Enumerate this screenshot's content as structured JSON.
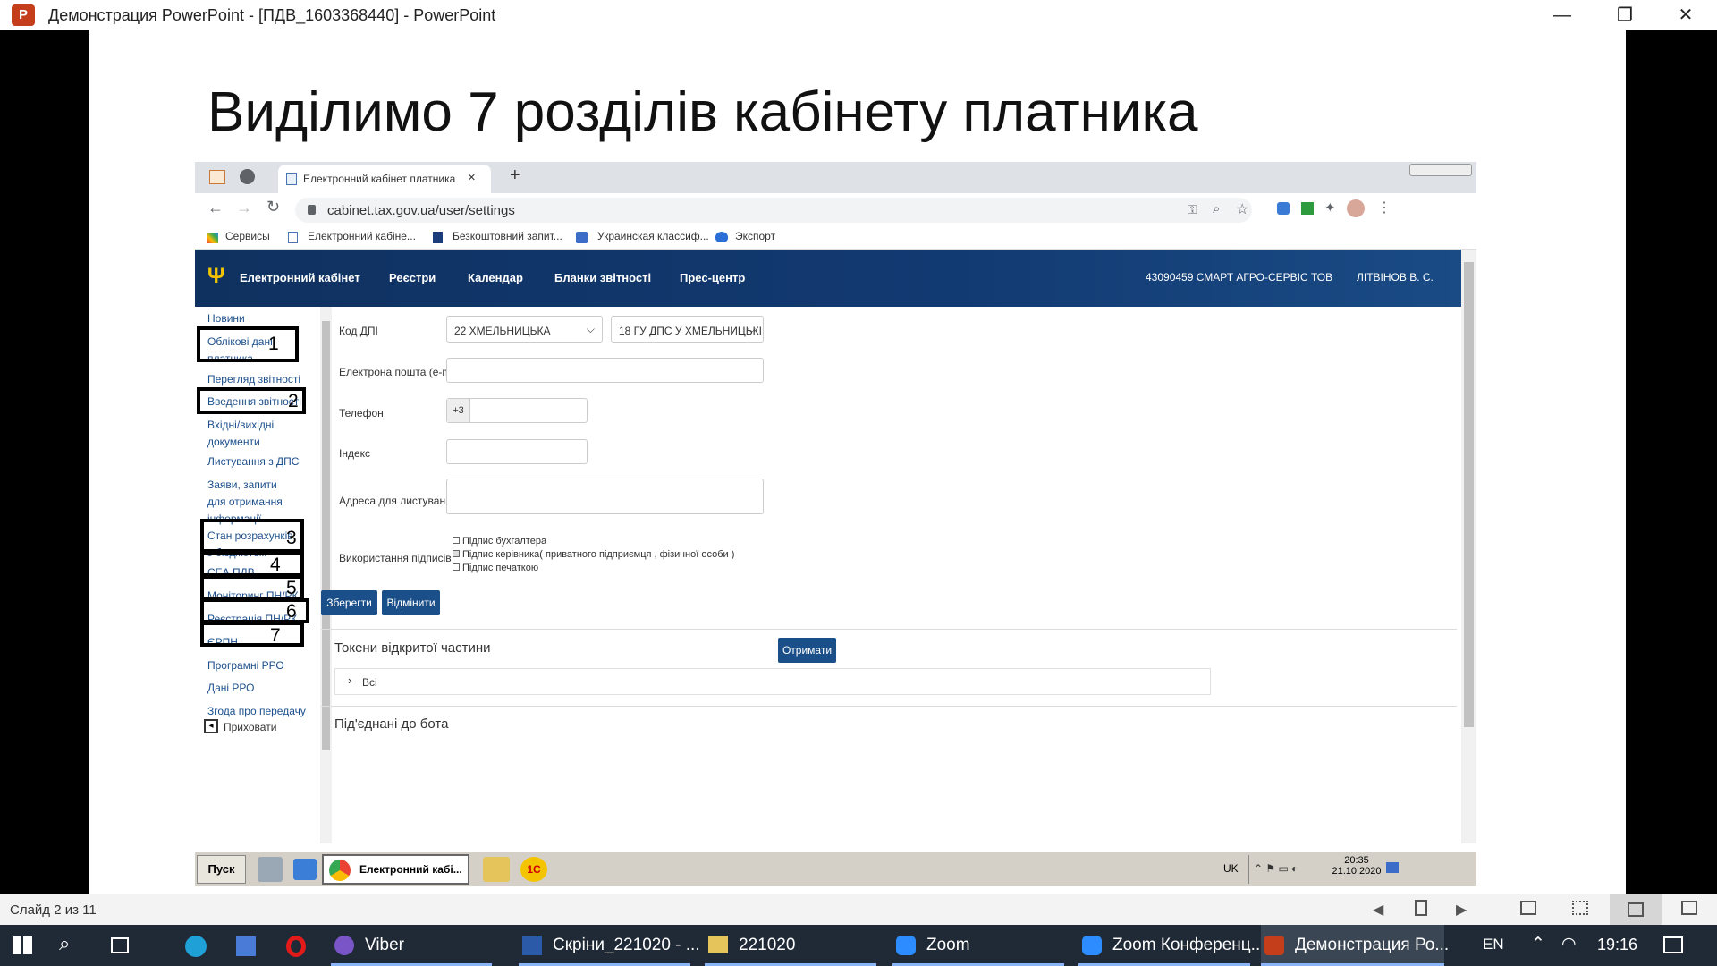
{
  "window": {
    "title": "Демонстрация PowerPoint - [ПДВ_1603368440] - PowerPoint",
    "minimize": "—",
    "restore": "❐",
    "close": "✕"
  },
  "slide": {
    "title": "Виділимо 7 розділів кабінету платника"
  },
  "browser": {
    "tab_title": "Електронний кабінет платника",
    "tab_close": "×",
    "new_tab": "+",
    "url": "cabinet.tax.gov.ua/user/settings",
    "bookmarks": [
      "Сервисы",
      "Електронний кабіне...",
      "Безкоштовний запит...",
      "Украинская классиф...",
      "Экспорт"
    ]
  },
  "site": {
    "nav": [
      "Електронний кабінет",
      "Реєстри",
      "Календар",
      "Бланки звітності",
      "Прес-центр"
    ],
    "company": "43090459 СМАРТ АГРО-СЕРВІС ТОВ",
    "user": "ЛІТВІНОВ В. С.",
    "sidebar": [
      "Новини",
      "Облікові дані платника",
      "Перегляд звітності",
      "Введення звітності",
      "Вхідні/вихідні документи",
      "Листування з ДПС",
      "Заяви, запити для отримання інформації",
      "Стан розрахунків з бюджетом",
      "СЕА ПДВ",
      "Моніторинг ПН/РК",
      "Реєстрація ПН/РК",
      "ЄРПН",
      "Програмні РРО",
      "Дані РРО",
      "Згода про передачу"
    ],
    "hide_label": "Приховати",
    "box_numbers": [
      "1",
      "2",
      "3",
      "4",
      "5",
      "6",
      "7"
    ],
    "form": {
      "dpi_label": "Код ДПІ",
      "dpi_value1": "22 ХМЕЛЬНИЦЬКА",
      "dpi_value2": "18 ГУ ДПС У ХМЕЛЬНИЦЬКІ...",
      "email_label": "Електрона пошта (e-mail)",
      "phone_label": "Телефон",
      "phone_prefix": "+3",
      "index_label": "Індекс",
      "address_label": "Адреса для листування",
      "sign_label": "Використання підписів",
      "sign_options": [
        "Підпис бухгалтера",
        "Підпис керівника( приватного підприємця , фізичної особи )",
        "Підпис печаткою"
      ],
      "save": "Зберегти",
      "cancel": "Відмінити"
    },
    "tokens_title": "Токени відкритої частини",
    "get_button": "Отримати",
    "all_label": "Всі",
    "bot_title": "Під'єднані до бота"
  },
  "xp_taskbar": {
    "start": "Пуск",
    "chrome": "Електронний кабі...",
    "lang": "UK",
    "time": "20:35",
    "date": "21.10.2020"
  },
  "status": {
    "slide_num": "Слайд 2 из 11"
  },
  "taskbar": {
    "apps": [
      "Viber",
      "Скріни_221020 - ...",
      "221020",
      "Zoom",
      "Zoom Конференц...",
      "Демонстрация Ро..."
    ],
    "lang": "EN",
    "time": "19:16"
  },
  "colors": {
    "nav": "#123a72",
    "link": "#1c4f8c",
    "button": "#1b4f8a",
    "taskbar": "#1f2a36"
  }
}
